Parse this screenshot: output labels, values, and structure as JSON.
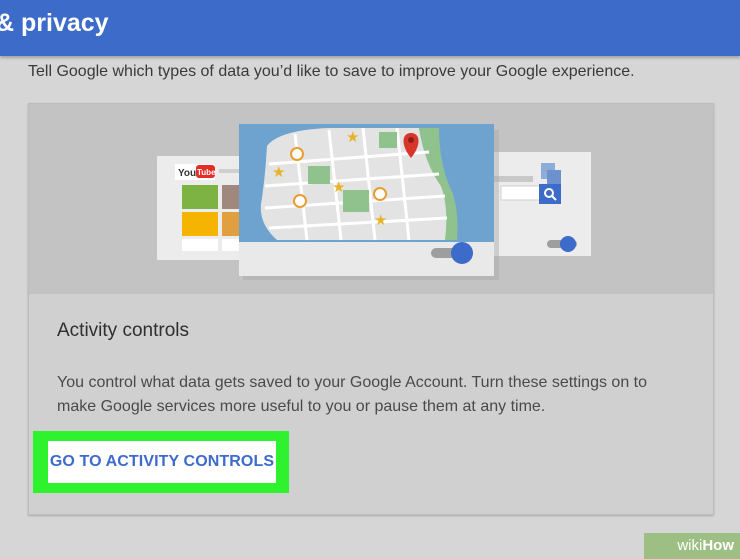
{
  "header": {
    "title": "& privacy"
  },
  "intro": {
    "text": "Tell Google which types of data you’d like to save to improve your Google experience."
  },
  "card": {
    "title": "Activity controls",
    "description": "You control what data gets saved to your Google Account. Turn these settings on to make Google services more useful to you or pause them at any time.",
    "cta_label": "GO TO ACTIVITY CONTROLS"
  },
  "illustration": {
    "youtube_brand_you": "You",
    "youtube_brand_tube": "Tube",
    "toggles": {
      "map_card": true,
      "search_card": true
    }
  },
  "watermark": {
    "prefix": "wiki",
    "suffix": "How"
  },
  "colors": {
    "header": "#3d6bc9",
    "accent_blue": "#3c6ad0",
    "highlight_green": "#2ff22f",
    "map_water": "#6ea3cf",
    "map_park": "#8fc28c",
    "star": "#e8b32a",
    "pin": "#d9362b"
  }
}
